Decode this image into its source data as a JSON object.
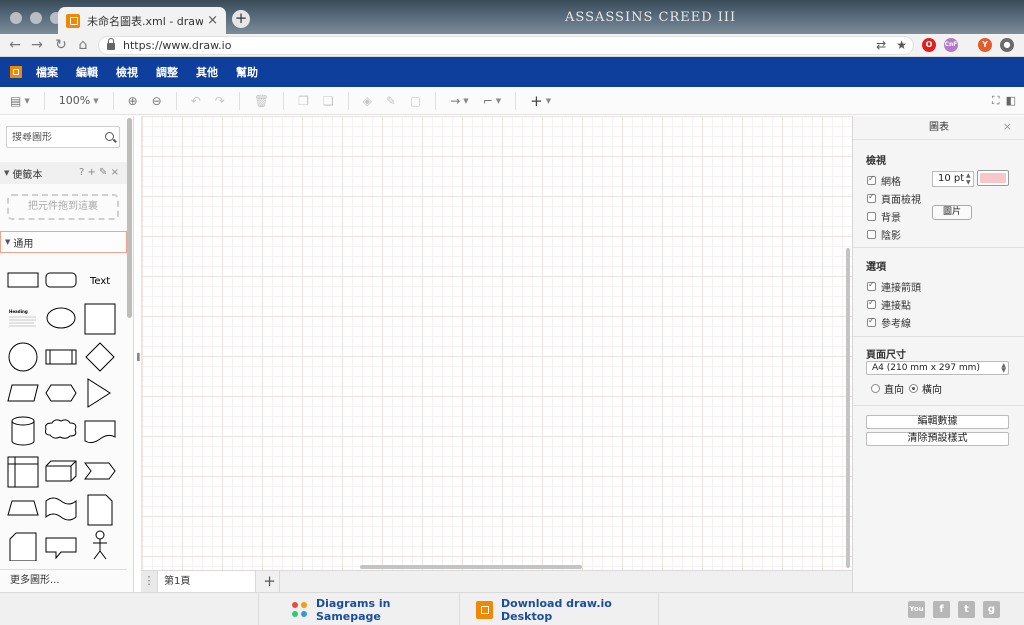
{
  "browser": {
    "tab_title": "未命名圖表.xml - draw.io",
    "tab_close": "×",
    "new_tab": "+",
    "theme_logo": "ASSASSINS CREED III",
    "url": "https://www.draw.io",
    "ext_badge_cnf": "CnF",
    "ext_badge_y": "Y"
  },
  "menubar": {
    "items": [
      "檔案",
      "編輯",
      "檢視",
      "調整",
      "其他",
      "幫助"
    ]
  },
  "toolbar": {
    "zoom": "100%"
  },
  "sidebar": {
    "search_placeholder": "搜尋圖形",
    "scratchpad_title": "便籤本",
    "scratchpad_icons": "? + ✎ ×",
    "scratchpad_drop": "把元件拖到這裏",
    "general_title": "通用",
    "text_shape": "Text",
    "heading_shape": "Heading",
    "more_shapes": "更多圖形..."
  },
  "pages": {
    "menu_icon": "⋮",
    "current": "第1頁",
    "add": "+"
  },
  "panel": {
    "title": "圖表",
    "close": "×",
    "view_section": "檢視",
    "grid": "網格",
    "grid_size": "10 pt",
    "page_view": "頁面檢視",
    "background": "背景",
    "shadow": "陰影",
    "image_button": "圖片",
    "options_section": "選項",
    "connection_arrows": "連接箭頭",
    "connection_points": "連接點",
    "guides": "參考線",
    "paper_size_section": "頁面尺寸",
    "paper_size": "A4 (210 mm x 297 mm)",
    "portrait": "直向",
    "landscape": "橫向",
    "edit_data": "編輯數據",
    "clear_default_style": "清除預設樣式",
    "grid_color": "#f8c8c8"
  },
  "footer": {
    "samepage": "Diagrams in Samepage",
    "desktop": "Download draw.io Desktop",
    "social": [
      "You",
      "f",
      "t",
      "g"
    ]
  }
}
